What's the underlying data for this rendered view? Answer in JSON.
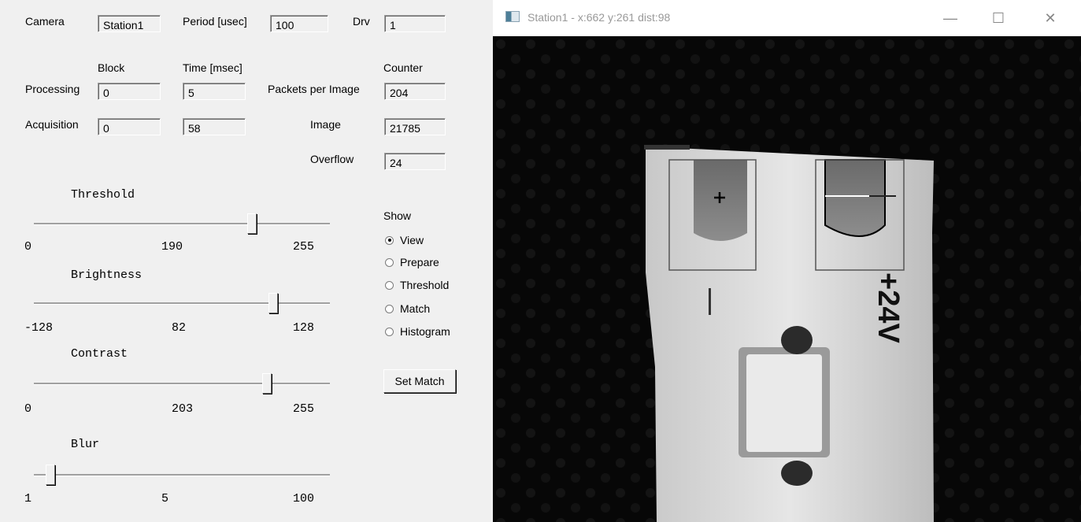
{
  "panel": {
    "camera_label": "Camera",
    "camera_value": "Station1",
    "period_label": "Period [usec]",
    "period_value": "100",
    "drv_label": "Drv",
    "drv_value": "1",
    "block_header": "Block",
    "time_header": "Time [msec]",
    "counter_header": "Counter",
    "processing_label": "Processing",
    "processing_block": "0",
    "processing_time": "5",
    "packets_label": "Packets per Image",
    "packets_value": "204",
    "acquisition_label": "Acquisition",
    "acquisition_block": "0",
    "acquisition_time": "58",
    "image_label": "Image",
    "image_value": "21785",
    "overflow_label": "Overflow",
    "overflow_value": "24"
  },
  "sliders": {
    "threshold": {
      "label": "Threshold",
      "min": "0",
      "value": "190",
      "max": "255",
      "fraction": 0.745
    },
    "brightness": {
      "label": "Brightness",
      "min": "-128",
      "value": "82",
      "max": "128",
      "fraction": 0.82
    },
    "contrast": {
      "label": "Contrast",
      "min": "0",
      "value": "203",
      "max": "255",
      "fraction": 0.796
    },
    "blur": {
      "label": "Blur",
      "min": "1",
      "value": "5",
      "max": "100",
      "fraction": 0.04
    }
  },
  "show": {
    "label": "Show",
    "options": [
      "View",
      "Prepare",
      "Threshold",
      "Match",
      "Histogram"
    ],
    "selected": "View"
  },
  "set_match_label": "Set Match",
  "window": {
    "title": "Station1 - x:662 y:261 dist:98",
    "minimize": "—",
    "maximize": "☐",
    "close": "✕"
  },
  "image": {
    "marking_text": "+24V",
    "hole_marker": "|"
  }
}
